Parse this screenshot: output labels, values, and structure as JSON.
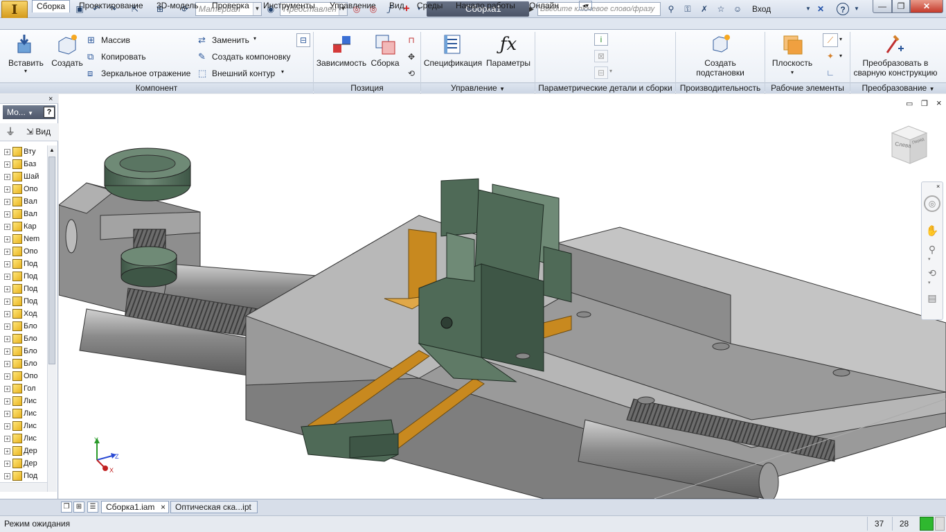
{
  "titlebar": {
    "material_placeholder": "Материал",
    "appearance_placeholder": "Представлен",
    "doc_title": "Сборка1",
    "search_placeholder": "Введите ключевое слово/фразу",
    "login": "Вход",
    "help": "?"
  },
  "tabs": [
    {
      "label": "Сборка"
    },
    {
      "label": "Проектирование"
    },
    {
      "label": "3D-модель"
    },
    {
      "label": "Проверка"
    },
    {
      "label": "Инструменты"
    },
    {
      "label": "Управление"
    },
    {
      "label": "Вид"
    },
    {
      "label": "Среды"
    },
    {
      "label": "Начало работы"
    },
    {
      "label": "Онлайн"
    }
  ],
  "ribbon": {
    "insert": "Вставить",
    "create": "Создать",
    "pattern": "Массив",
    "copy": "Копировать",
    "mirror": "Зеркальное отражение",
    "replace": "Заменить",
    "create_layout": "Создать компоновку",
    "shrinkwrap": "Внешний контур",
    "constraint": "Зависимость",
    "assemble": "Сборка",
    "bom": "Спецификация",
    "parameters": "Параметры",
    "create_substitutes_1": "Создать",
    "create_substitutes_2": "подстановки",
    "plane": "Плоскость",
    "convert_1": "Преобразовать в",
    "convert_2": "сварную конструкцию",
    "panels": {
      "component": "Компонент",
      "position": "Позиция",
      "manage": "Управление",
      "ipart": "Параметрические детали и сборки",
      "productivity": "Производительность",
      "work_features": "Рабочие элементы",
      "convert": "Преобразование"
    }
  },
  "browser": {
    "header": "Мо...",
    "view_label": "Вид",
    "items": [
      "Вту",
      "Баз",
      "Шай",
      "Опо",
      "Вал",
      "Вал",
      "Кар",
      "Nem",
      "Опо",
      "Под",
      "Под",
      "Под",
      "Под",
      "Ход",
      "Бло",
      "Бло",
      "Бло",
      "Бло",
      "Опо",
      "Гол",
      "Лис",
      "Лис",
      "Лис",
      "Лис",
      "Дер",
      "Дер",
      "Под"
    ]
  },
  "viewcube": {
    "label_left": "Слева",
    "label_front": "Перед"
  },
  "triad": {
    "x": "X",
    "y": "Y",
    "z": "Z"
  },
  "doc_tabs": [
    "Сборка1.iam",
    "Оптическая ска...ipt"
  ],
  "status": {
    "text": "Режим ожидания",
    "count1": "37",
    "count2": "28"
  },
  "colors": {
    "accent": "#2b579a",
    "part_green": "#4f6a57",
    "part_gray": "#8f8f8f",
    "brass": "#c8891f"
  }
}
